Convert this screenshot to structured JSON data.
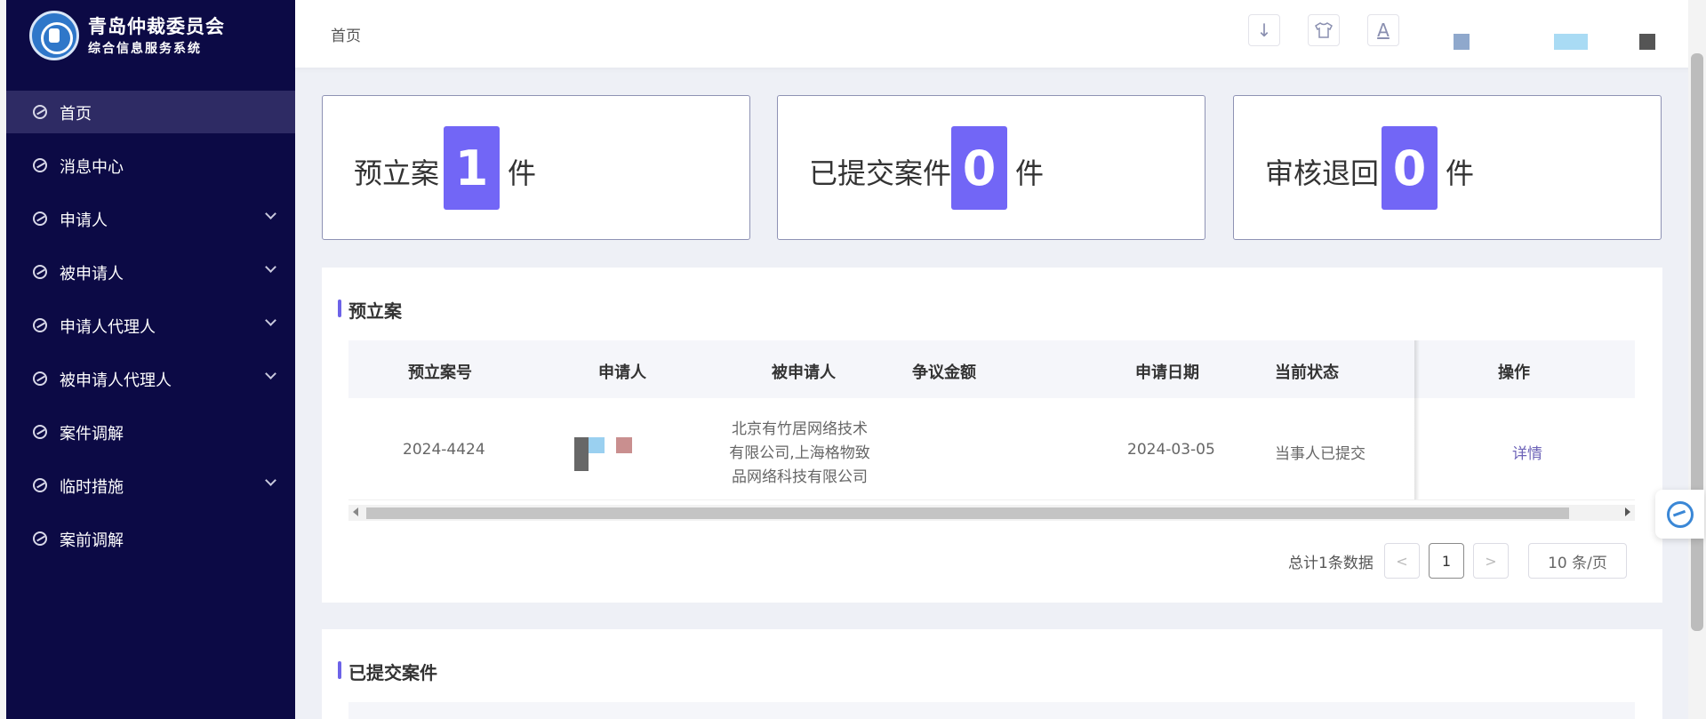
{
  "app": {
    "title": "青岛仲裁委员会",
    "subtitle": "综合信息服务系统"
  },
  "sidebar": {
    "items": [
      {
        "label": "首页",
        "active": true,
        "expandable": false
      },
      {
        "label": "消息中心",
        "active": false,
        "expandable": false
      },
      {
        "label": "申请人",
        "active": false,
        "expandable": true
      },
      {
        "label": "被申请人",
        "active": false,
        "expandable": true
      },
      {
        "label": "申请人代理人",
        "active": false,
        "expandable": true
      },
      {
        "label": "被申请人代理人",
        "active": false,
        "expandable": true
      },
      {
        "label": "案件调解",
        "active": false,
        "expandable": false
      },
      {
        "label": "临时措施",
        "active": false,
        "expandable": true
      },
      {
        "label": "案前调解",
        "active": false,
        "expandable": false
      }
    ]
  },
  "header": {
    "breadcrumb": "首页",
    "icons": [
      "download-icon",
      "theme-shirt-icon",
      "font-size-icon"
    ],
    "glyphs": {
      "download": "↓",
      "shirt": "👕",
      "font": "A"
    }
  },
  "stats": [
    {
      "label": "预立案",
      "value": "1",
      "unit": "件"
    },
    {
      "label": "已提交案件",
      "value": "0",
      "unit": "件"
    },
    {
      "label": "审核退回",
      "value": "0",
      "unit": "件"
    }
  ],
  "pre_case_panel": {
    "title": "预立案",
    "columns": [
      "预立案号",
      "申请人",
      "被申请人",
      "争议金额",
      "申请日期",
      "当前状态",
      "操作"
    ],
    "rows": [
      {
        "case_no": "2024-4424",
        "applicant": "",
        "respondent": "北京有竹居网络技术有限公司,上海格物致品网络科技有限公司",
        "amount": "",
        "date": "2024-03-05",
        "status": "当事人已提交",
        "action": "详情"
      }
    ],
    "pagination": {
      "total_text": "总计1条数据",
      "prev": "<",
      "current_page": "1",
      "next": ">",
      "page_size": "10 条/页"
    }
  },
  "submitted_panel": {
    "title": "已提交案件"
  },
  "colors": {
    "sidebar_bg": "#0c0a45",
    "sidebar_active": "#2e2b64",
    "accent": "#7266f6",
    "link": "#6d63b8"
  }
}
